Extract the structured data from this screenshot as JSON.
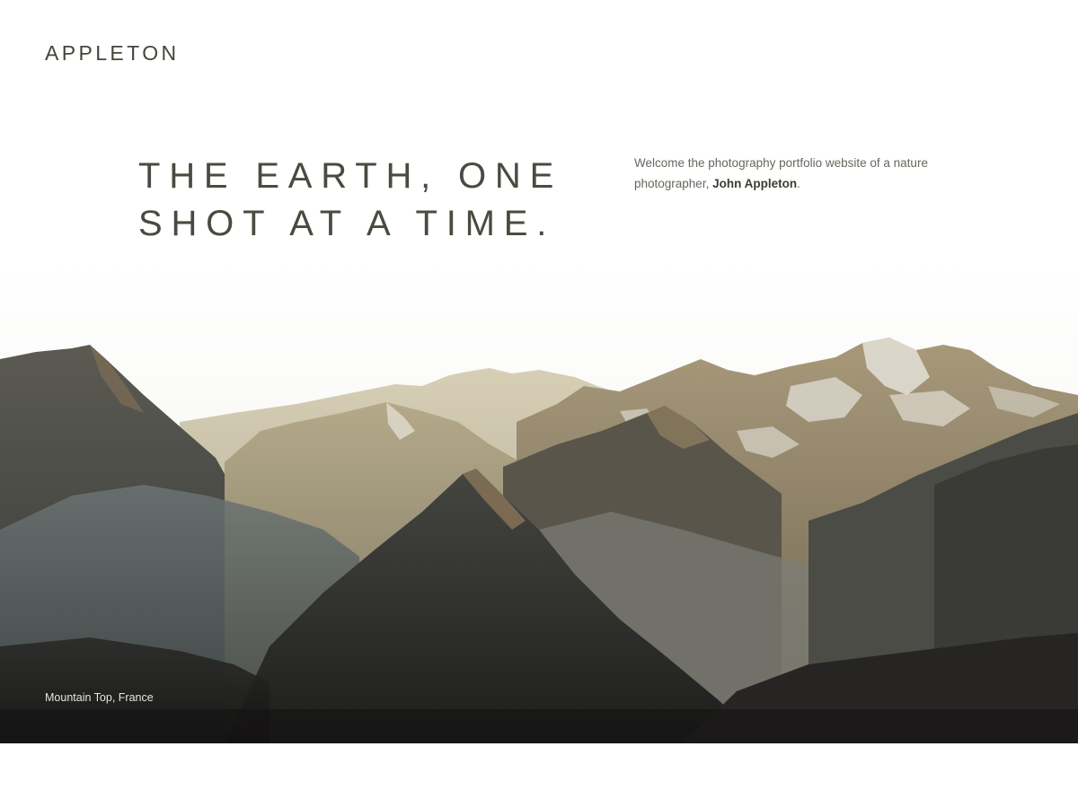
{
  "header": {
    "logo": "APPLETON"
  },
  "hero": {
    "headline_line1": "THE EARTH, ONE",
    "headline_line2": "SHOT AT A TIME.",
    "intro_before": "Welcome the photography portfolio website of a nature photographer, ",
    "intro_name": "John Appleton",
    "intro_after": ".",
    "photo_caption": "Mountain Top, France"
  },
  "colors": {
    "text": "#4a4a41",
    "background": "#ffffff",
    "caption": "#e7e4dc"
  }
}
